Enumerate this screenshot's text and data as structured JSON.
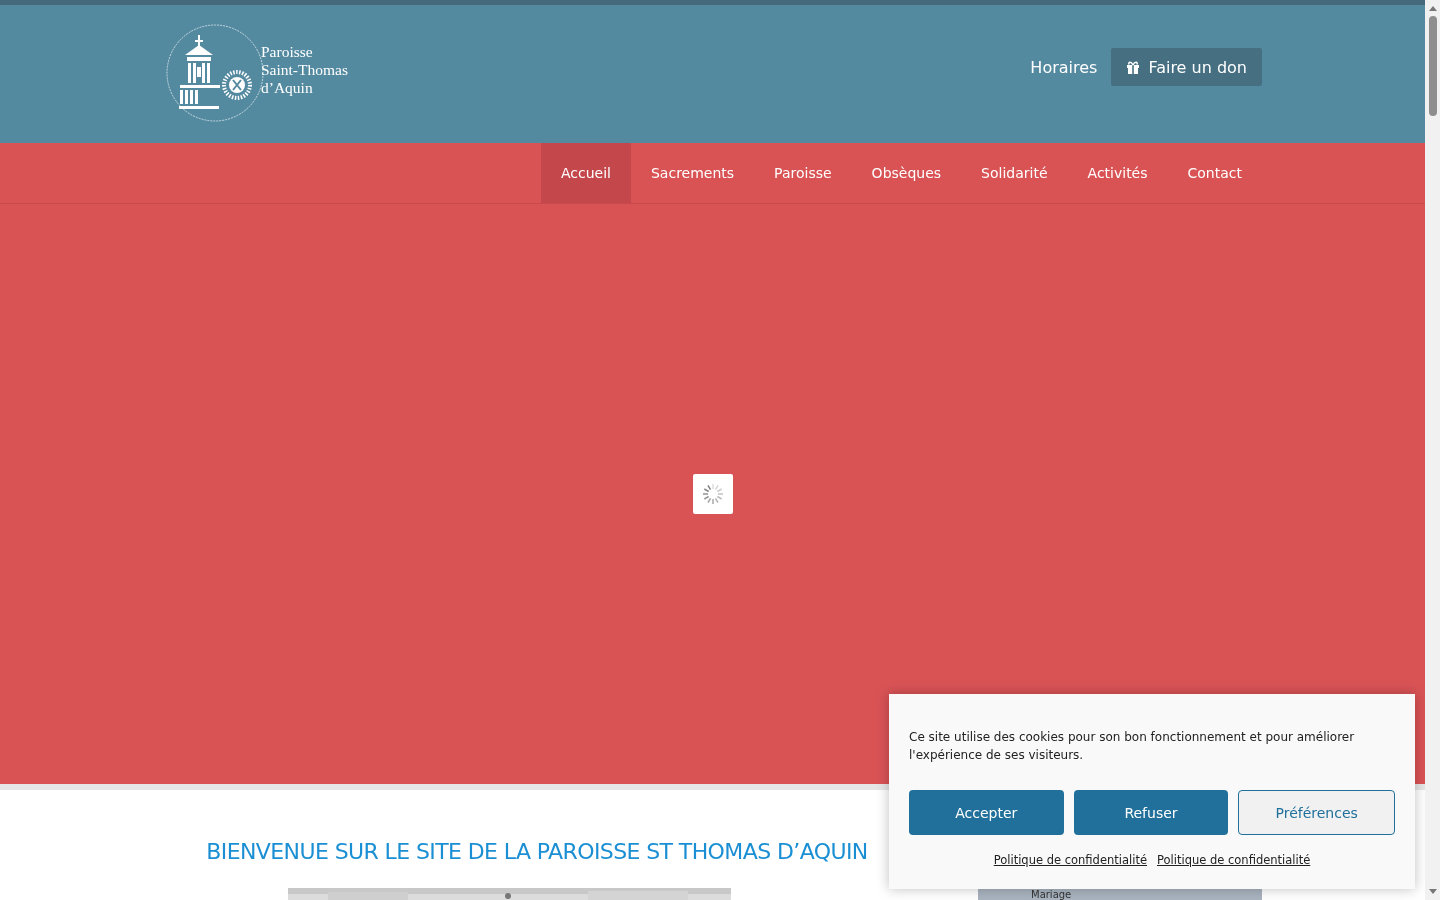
{
  "header": {
    "logo_lines": [
      "Paroisse",
      "Saint-Thomas",
      "d’Aquin"
    ],
    "links": [
      {
        "kind": "link",
        "label": "Horaires"
      },
      {
        "kind": "donate",
        "label": "Faire un don"
      }
    ]
  },
  "nav": [
    {
      "label": "Accueil",
      "selected": true
    },
    {
      "label": "Sacrements",
      "selected": false
    },
    {
      "label": "Paroisse",
      "selected": false
    },
    {
      "label": "Obsèques",
      "selected": false
    },
    {
      "label": "Solidarité",
      "selected": false
    },
    {
      "label": "Activités",
      "selected": false
    },
    {
      "label": "Contact",
      "selected": false
    }
  ],
  "hero": {
    "loading": true
  },
  "main": {
    "heading": "BIENVENUE SUR LE SITE DE LA PAROISSE ST THOMAS D’AQUIN",
    "sidebar_item": "Mariage"
  },
  "cookie_banner": {
    "message": "Ce site utilise des cookies pour son bon fonctionnement et pour améliorer l'expérience de ses visiteurs.",
    "buttons": [
      {
        "kind": "primary",
        "label": "Accepter"
      },
      {
        "kind": "primary",
        "label": "Refuser"
      },
      {
        "kind": "secondary",
        "label": "Préférences"
      }
    ],
    "links": [
      "Politique de confidentialité",
      "Politique de confidentialité"
    ]
  }
}
